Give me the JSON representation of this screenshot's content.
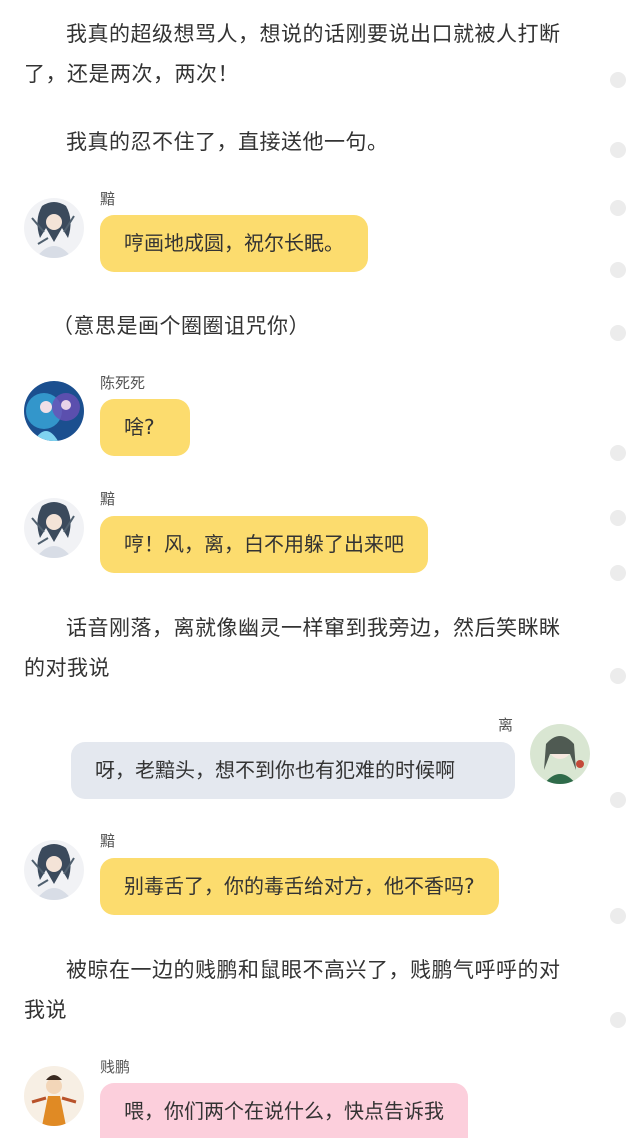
{
  "story": {
    "p1_top": "我真的超级想骂人，想说的话刚要说出口就被人打断",
    "p1_bottom": "了，还是两次，两次！",
    "p2": "我真的忍不住了，直接送他一句。",
    "p3": "（意思是画个圈圈诅咒你）",
    "p4a": "话音刚落，离就像幽灵一样窜到我旁边，然后笑眯眯",
    "p4b": "的对我说",
    "p5a": "被晾在一边的贱鹏和鼠眼不高兴了，贱鹏气呼呼的对",
    "p5b": "我说"
  },
  "messages": [
    {
      "sender": "黯",
      "text": "哼画地成圆，祝尔长眠。",
      "avatar_icon": "anime-avatar-icon"
    },
    {
      "sender": "陈死死",
      "text": "啥?",
      "avatar_icon": "anime-avatar-icon"
    },
    {
      "sender": "黯",
      "text": "哼！风，离，白不用躲了出来吧",
      "avatar_icon": "anime-avatar-icon"
    },
    {
      "sender": "离",
      "text": "呀，老黯头，想不到你也有犯难的时候啊",
      "avatar_icon": "anime-avatar-icon"
    },
    {
      "sender": "黯",
      "text": "别毒舌了，你的毒舌给对方，他不香吗?",
      "avatar_icon": "anime-avatar-icon"
    },
    {
      "sender": "贱鹏",
      "text": "喂，你们两个在说什么，快点告诉我",
      "avatar_icon": "anime-avatar-icon"
    }
  ],
  "colors": {
    "bubble_yellow": "#fcdc6e",
    "bubble_gray": "#e4e8ef",
    "bubble_pink": "#fccfdc"
  }
}
